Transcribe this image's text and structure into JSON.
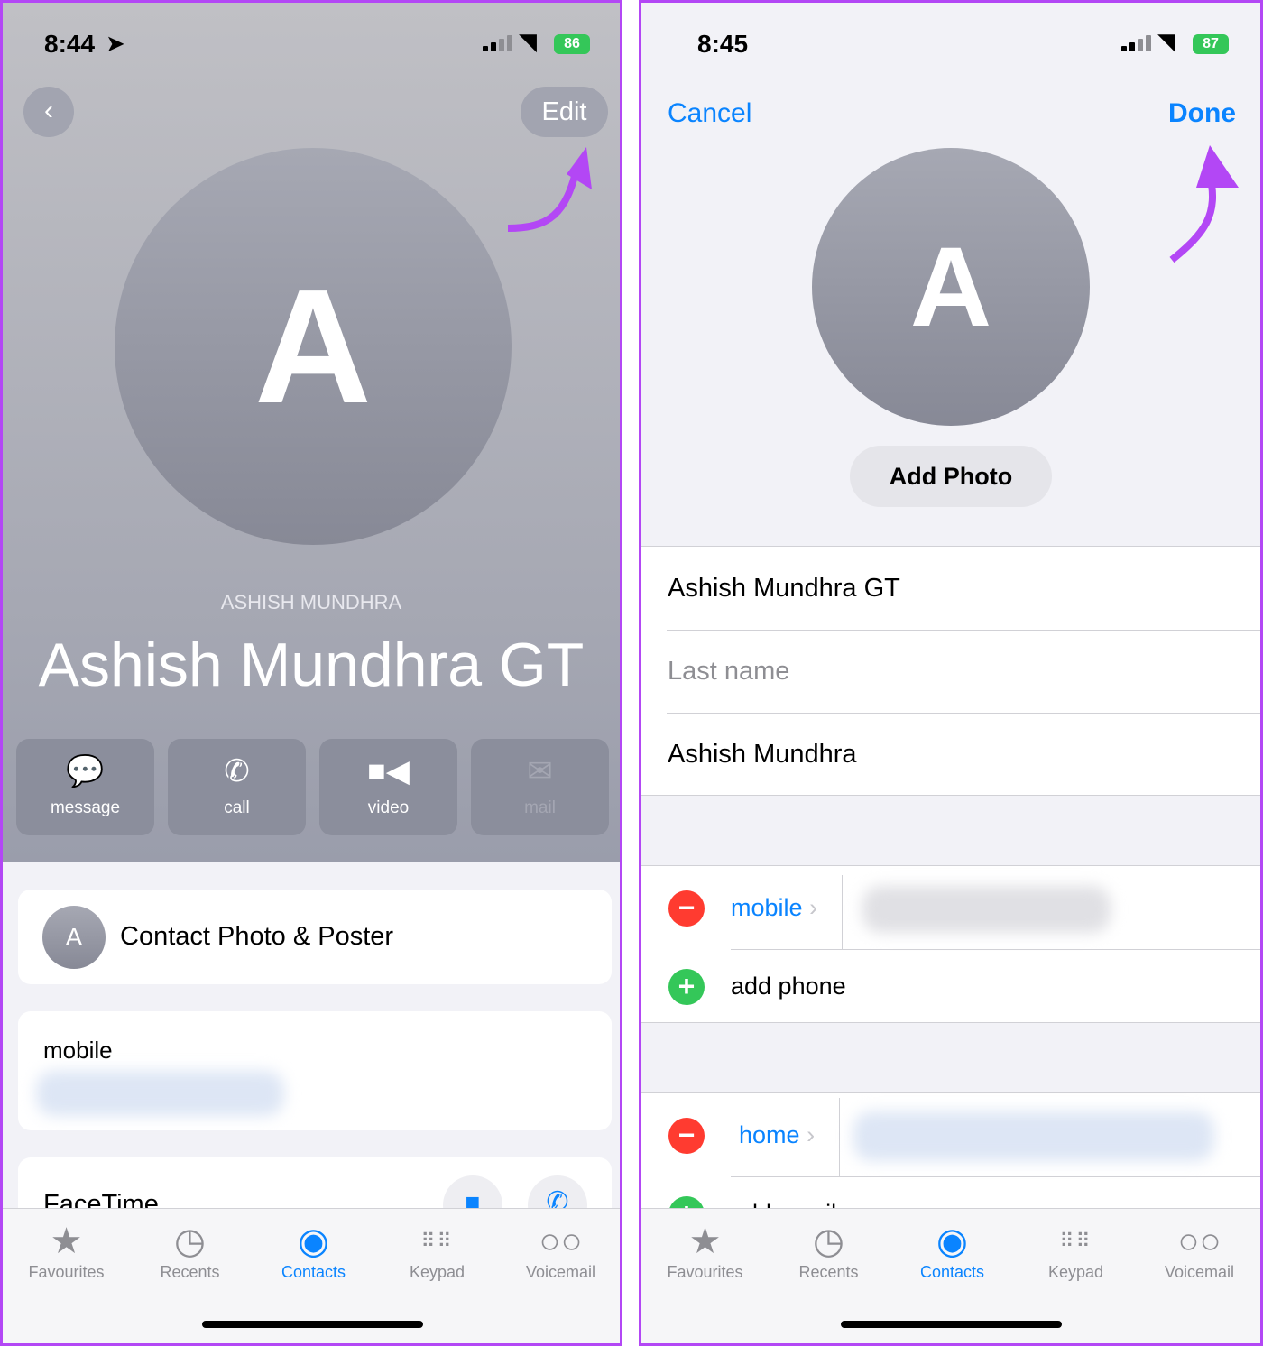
{
  "accent": "#0a84ff",
  "annotation_color": "#b347f5",
  "left": {
    "status": {
      "time": "8:44",
      "battery": "86"
    },
    "edit_label": "Edit",
    "avatar_letter": "A",
    "subtitle": "ASHISH MUNDHRA",
    "name": "Ashish Mundhra GT",
    "actions": [
      {
        "label": "message",
        "icon": "message-icon"
      },
      {
        "label": "call",
        "icon": "phone-icon"
      },
      {
        "label": "video",
        "icon": "video-icon"
      },
      {
        "label": "mail",
        "icon": "mail-icon"
      }
    ],
    "poster_label": "Contact Photo & Poster",
    "poster_letter": "A",
    "mobile_label": "mobile",
    "facetime_label": "FaceTime"
  },
  "right": {
    "status": {
      "time": "8:45",
      "battery": "87"
    },
    "cancel_label": "Cancel",
    "done_label": "Done",
    "avatar_letter": "A",
    "add_photo_label": "Add Photo",
    "first_name": "Ashish Mundhra GT",
    "last_name_placeholder": "Last name",
    "company": "Ashish Mundhra",
    "phone_label": "mobile",
    "add_phone": "add phone",
    "email_label": "home",
    "add_email": "add email"
  },
  "tabs": [
    {
      "label": "Favourites",
      "icon": "star-icon"
    },
    {
      "label": "Recents",
      "icon": "clock-icon"
    },
    {
      "label": "Contacts",
      "icon": "person-icon",
      "active": true
    },
    {
      "label": "Keypad",
      "icon": "keypad-icon"
    },
    {
      "label": "Voicemail",
      "icon": "voicemail-icon"
    }
  ]
}
